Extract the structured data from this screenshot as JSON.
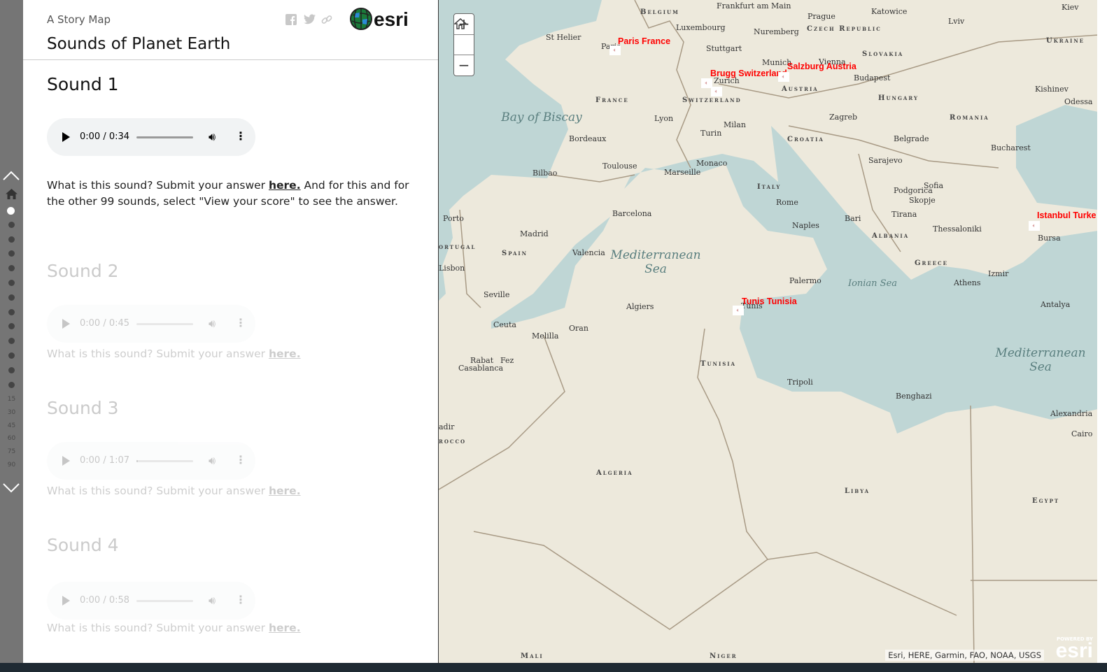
{
  "header": {
    "subtitle": "A Story Map",
    "title": "Sounds of Planet Earth",
    "share_icons": [
      "facebook-icon",
      "twitter-icon",
      "link-icon"
    ],
    "logo": "esri"
  },
  "nav": {
    "numbers": [
      "15",
      "30",
      "45",
      "60",
      "75",
      "90"
    ],
    "dot_count": 13,
    "active_index": 0
  },
  "sections": [
    {
      "title": "Sound 1",
      "time": "0:00 / 0:34",
      "progress": 0,
      "text": "What is this sound? Submit your answer ",
      "link": "here.",
      "text2": " And for this and for the other 99 sounds, select \"View your score\" to see the answer."
    },
    {
      "title": "Sound 2",
      "time": "0:00 / 0:45",
      "progress": 0,
      "text": "What is this sound? Submit your answer ",
      "link": "here."
    },
    {
      "title": "Sound 3",
      "time": "0:00 / 1:07",
      "progress": 0.03,
      "text": "What is this sound? Submit your answer ",
      "link": "here."
    },
    {
      "title": "Sound 4",
      "time": "0:00 / 0:58",
      "progress": 0,
      "text": "What is this sound? Submit your answer ",
      "link": "here."
    }
  ],
  "map": {
    "zoom_in": "+",
    "zoom_out": "−",
    "home": "home-icon",
    "attribution": "Esri, HERE, Garmin, FAO, NOAA, USGS",
    "powered": "POWERED BY",
    "powered_logo": "esri",
    "markers": [
      "Paris France",
      "Brugg Switzerland",
      "Salzburg Austria",
      "Istanbul Turke",
      "Tunis Tunisia"
    ],
    "cities": [
      "Frankfurt am Main",
      "Prague",
      "Katowice",
      "Lviv",
      "Kiev",
      "Luxembourg",
      "Nuremberg",
      "St Helier",
      "Paris",
      "Stuttgart",
      "Munich",
      "Vienna",
      "Zurich",
      "Budapest",
      "Kishinev",
      "Odessa",
      "Lyon",
      "Milan",
      "Zagreb",
      "Turin",
      "Bordeaux",
      "Belgrade",
      "Bucharest",
      "Toulouse",
      "Marseille",
      "Monaco",
      "Bilbao",
      "Sarajevo",
      "Sofia",
      "Podgorica",
      "Skopje",
      "Rome",
      "Bari",
      "Tirana",
      "Thessaloniki",
      "Bursa",
      "Barcelona",
      "Porto",
      "Madrid",
      "Naples",
      "Valencia",
      "Lisbon",
      "Palermo",
      "Athens",
      "Izmir",
      "Seville",
      "Algiers",
      "Antalya",
      "Tunis",
      "Ceuta",
      "Melilla",
      "Oran",
      "Rabat",
      "Fez",
      "Casablanca",
      "Tripoli",
      "Benghazi",
      "Alexandria",
      "Cairo",
      "adir"
    ],
    "countries": [
      "Belgium",
      "Czech Republic",
      "Slovakia",
      "Ukraine",
      "Austria",
      "France",
      "Switzerland",
      "Hungary",
      "Romania",
      "Croatia",
      "Italy",
      "Spain",
      "ortugal",
      "Albania",
      "Greece",
      "Tunisia",
      "Algeria",
      "Libya",
      "Egypt",
      "Mali",
      "Niger",
      "rocco"
    ],
    "seas": [
      "Bay of Biscay",
      "Mediterranean Sea",
      "Ionian Sea",
      "Mediterranean Sea"
    ],
    "colors": {
      "land": "#ede9dc",
      "sea": "#bfd6d5",
      "marker_label": "#ff0000"
    }
  }
}
